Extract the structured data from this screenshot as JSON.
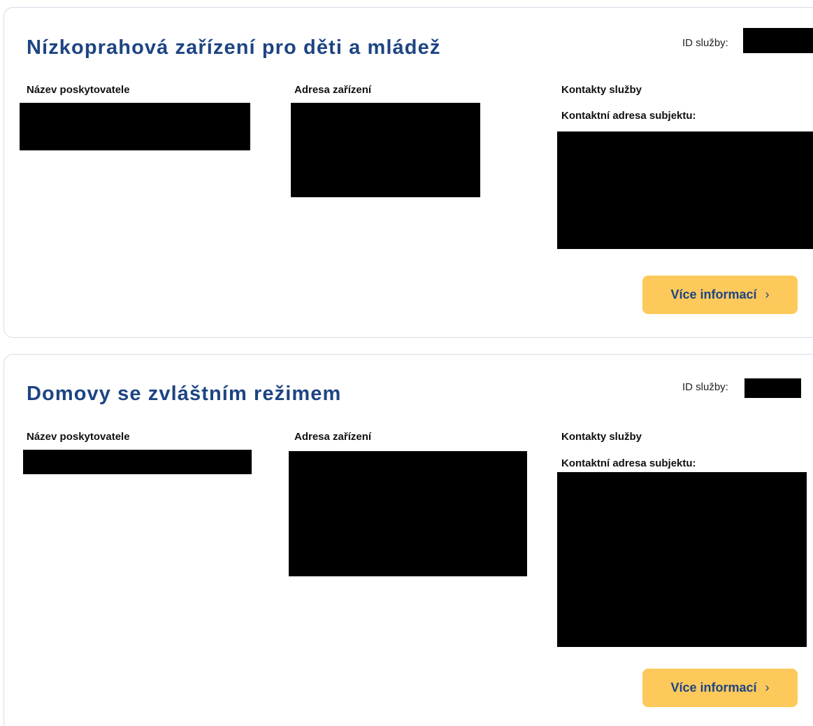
{
  "services": [
    {
      "title": "Nízkoprahová zařízení pro děti a mládež",
      "id_label": "ID služby:",
      "provider_label": "Název poskytovatele",
      "address_label": "Adresa zařízení",
      "contacts_label": "Kontakty služby",
      "contact_address_label": "Kontaktní adresa subjektu:",
      "more_button": "Více informací",
      "chevron": "›"
    },
    {
      "title": "Domovy se zvláštním režimem",
      "id_label": "ID služby:",
      "provider_label": "Název poskytovatele",
      "address_label": "Adresa zařízení",
      "contacts_label": "Kontakty služby",
      "contact_address_label": "Kontaktní adresa subjektu:",
      "more_button": "Více informací",
      "chevron": "›"
    }
  ],
  "colors": {
    "title": "#1d4483",
    "button_bg": "#fdc95a",
    "card_border": "#d6dbe4",
    "redaction": "#000000"
  }
}
